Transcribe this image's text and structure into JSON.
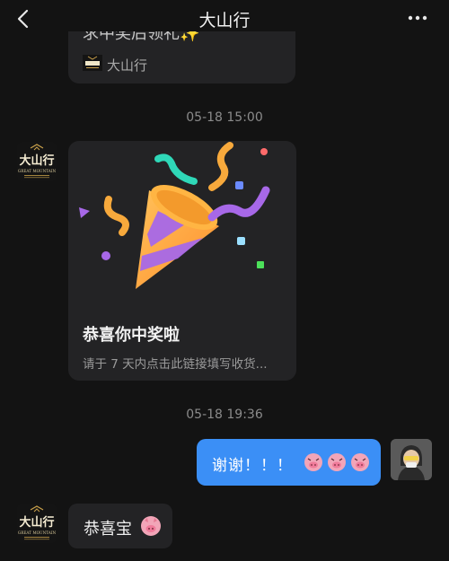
{
  "header": {
    "title": "大山行",
    "back_icon": "chevron-left-icon",
    "more_icon": "more-dots-icon"
  },
  "top_card": {
    "cut_title_fragment": "求中奖后领礼✨",
    "source_name": "大山行"
  },
  "timestamps": {
    "first": "05-18 15:00",
    "second": "05-18 19:36"
  },
  "prize_card": {
    "title": "恭喜你中奖啦",
    "description": "请于 7 天内点击此链接填写收货..."
  },
  "messages": {
    "outgoing_text": "谢谢！！！",
    "outgoing_emoji": "pig-face-icon",
    "incoming_text": "恭喜宝",
    "incoming_emoji": "pig-face-icon"
  },
  "brand": {
    "logo_cn": "大山行",
    "logo_en": "GREAT MOUNTAIN"
  },
  "colors": {
    "background": "#131313",
    "card": "#232325",
    "accent_blue": "#3b8ff6"
  }
}
